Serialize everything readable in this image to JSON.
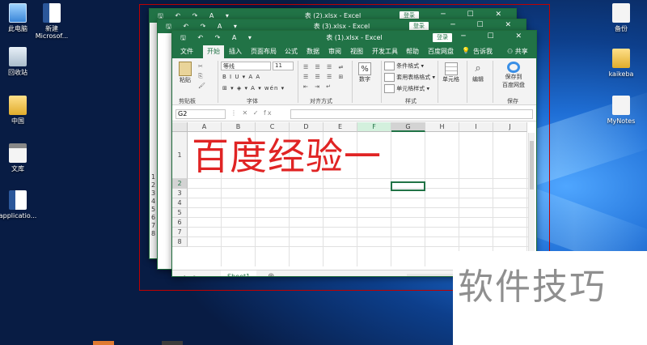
{
  "desktop": {
    "icons_left": [
      {
        "name": "this-pc",
        "label": "此电脑"
      },
      {
        "name": "new-word-doc",
        "label": "新建\nMicrosof..."
      },
      {
        "name": "recycle-bin",
        "label": "回收站"
      },
      {
        "name": "folder-china",
        "label": "中国"
      },
      {
        "name": "doc-library",
        "label": "文库"
      },
      {
        "name": "application-file",
        "label": "applicatio..."
      }
    ],
    "icons_right": [
      {
        "name": "backup",
        "label": "备份"
      },
      {
        "name": "kaikeba",
        "label": "kaikeba"
      },
      {
        "name": "mynotes",
        "label": "MyNotes"
      }
    ]
  },
  "back_windows": [
    {
      "title": "表 (2).xlsx  -  Excel",
      "login": "登录"
    },
    {
      "title": "表 (3).xlsx  -  Excel",
      "login": "登录"
    }
  ],
  "back_window_row_numbers": [
    "1",
    "2",
    "3",
    "4",
    "5",
    "6",
    "7",
    "8"
  ],
  "excel": {
    "title": "表 (1).xlsx  -  Excel",
    "login": "登录",
    "quick_access": "🖫 ↶ ↷ A ▾",
    "window_controls": "▭ ─ ☐ ✕",
    "tabs": [
      "文件",
      "开始",
      "插入",
      "页面布局",
      "公式",
      "数据",
      "审阅",
      "视图",
      "开发工具",
      "帮助",
      "百度网盘"
    ],
    "tell_me_icon": "lightbulb-icon",
    "tell_me": "告诉我",
    "share": "共享",
    "ribbon": {
      "paste": "粘贴",
      "font_name": "等线",
      "font_size": "11",
      "font_buttons": "B I U ▾ A A",
      "font_buttons2": "⊞ ▾ ◈ ▾ A ▾ wén ▾",
      "number": "数字",
      "number_symbol": "%",
      "cond_format": "条件格式 ▾",
      "table_format": "套用表格格式 ▾",
      "cell_style": "单元格样式 ▾",
      "cells": "单元格",
      "editing": "编辑",
      "save_to_baidu_line1": "保存到",
      "save_to_baidu_line2": "百度网盘",
      "groups": [
        "剪贴板",
        "字体",
        "对齐方式",
        "样式",
        "保存"
      ]
    },
    "name_box": "G2",
    "formula_icons": "⋮  ✕  ✓  fx",
    "columns": [
      "A",
      "B",
      "C",
      "D",
      "E",
      "F",
      "G",
      "H",
      "I",
      "J"
    ],
    "rows": [
      "1",
      "2",
      "3",
      "4",
      "5",
      "6",
      "7",
      "8"
    ],
    "cell_A1_text": "百度经验一",
    "sheet_tab": "Sheet1",
    "add_sheet": "⊕",
    "sheet_nav": "◂ ▸",
    "accent_color": "#217346"
  },
  "watermark": "软件技巧"
}
